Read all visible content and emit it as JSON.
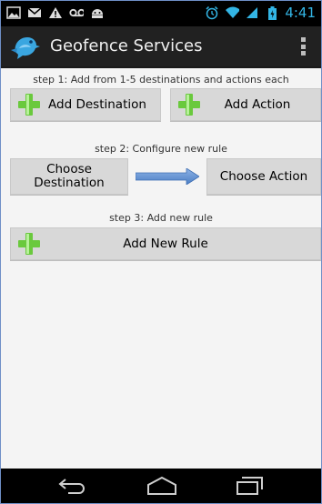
{
  "status_bar": {
    "time": "4:41",
    "left_icons": [
      "picture-icon",
      "mail-icon",
      "warning-icon",
      "voicemail-icon",
      "android-icon"
    ],
    "right_icons": [
      "alarm-icon",
      "wifi-icon",
      "signal-icon",
      "battery-icon"
    ]
  },
  "action_bar": {
    "title": "Geofence Services",
    "logo": "bird-logo-icon",
    "overflow": "overflow-menu-icon"
  },
  "step1": {
    "label": "step 1: Add from 1-5 destinations and actions each",
    "add_destination": "Add Destination",
    "add_action": "Add Action"
  },
  "step2": {
    "label": "step 2: Configure new rule",
    "choose_destination": "Choose Destination",
    "choose_action": "Choose Action",
    "arrow": "right-arrow-icon"
  },
  "step3": {
    "label": "step 3: Add new rule",
    "add_new_rule": "Add New Rule"
  },
  "nav_bar": {
    "icons": [
      "back-icon",
      "home-icon",
      "recent-apps-icon"
    ]
  }
}
